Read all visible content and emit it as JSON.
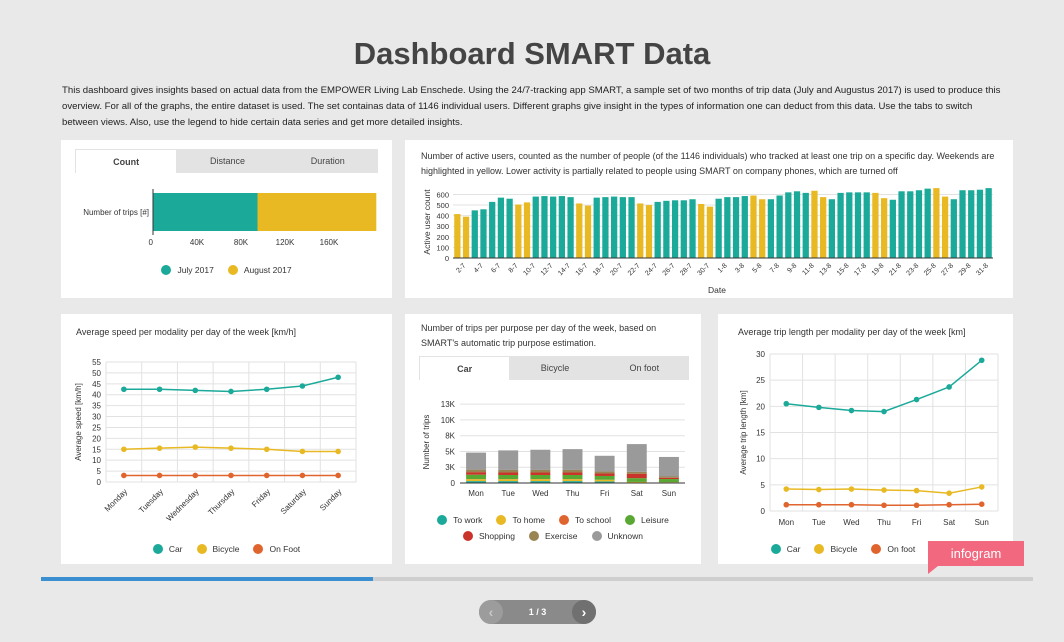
{
  "page": {
    "title": "Dashboard SMART Data",
    "intro": "This dashboard gives insights based on actual data from the EMPOWER Living Lab Enschede. Using the 24/7-tracking app SMART, a sample set of two months of trip data (July and Augustus 2017) is used to produce this overview. For all of the graphs, the entire dataset is used. The set containas data of 1146 individual users. Different graphs give insight in the types of information one can deduct from this data. Use the tabs to switch between views. Also,  use the legend to hide certain data series and get more detailed insights."
  },
  "colors": {
    "teal": "#1ba99a",
    "yellow": "#e8b923",
    "orange": "#e0642d",
    "green": "#5aa834",
    "red": "#c9342a",
    "brown": "#9a8453",
    "gray": "#9a9a9a",
    "accent": "#3a8fd1",
    "infogram": "#f2687f"
  },
  "trips_panel": {
    "tabs": [
      "Count",
      "Distance",
      "Duration"
    ],
    "active_tab": 0
  },
  "active_users_panel": {
    "title": "Number of active users, counted as the number of people (of the 1146 individuals) who tracked at least one trip on a specific day. Weekends are highlighted in yellow. Lower activity is partially related to people using SMART on company phones, which are turned off"
  },
  "speed_panel": {
    "title": "Average speed per modality per day of the week [km/h]"
  },
  "purpose_panel": {
    "title": "Number of trips per purpose per day of the week, based on SMART's automatic trip purpose estimation.",
    "tabs": [
      "Car",
      "Bicycle",
      "On foot"
    ],
    "active_tab": 0
  },
  "length_panel": {
    "title": "Average trip length per modality per day of the week [km]"
  },
  "chart_data": [
    {
      "type": "bar",
      "orientation": "horizontal",
      "stacked": true,
      "categories": [
        "Number of trips [#]"
      ],
      "series": [
        {
          "name": "July 2017",
          "values": [
            95000
          ]
        },
        {
          "name": "August 2017",
          "values": [
            108000
          ]
        }
      ],
      "xticks": [
        "0",
        "40K",
        "80K",
        "120K",
        "160K"
      ],
      "xlim": [
        0,
        200000
      ],
      "legend": "bottom"
    },
    {
      "type": "bar",
      "xlabel": "Date",
      "ylabel": "Active user count",
      "yticks": [
        0,
        100,
        200,
        300,
        400,
        500,
        600
      ],
      "ylim": [
        0,
        680
      ],
      "xtick_labels": [
        "2-7",
        "4-7",
        "6-7",
        "8-7",
        "10-7",
        "12-7",
        "14-7",
        "16-7",
        "18-7",
        "20-7",
        "22-7",
        "24-7",
        "26-7",
        "28-7",
        "30-7",
        "1-8",
        "3-8",
        "5-8",
        "7-8",
        "9-8",
        "11-8",
        "13-8",
        "15-8",
        "17-8",
        "19-8",
        "21-8",
        "23-8",
        "25-8",
        "27-8",
        "29-8",
        "31-8"
      ],
      "categories": [
        "1-7",
        "2-7",
        "3-7",
        "4-7",
        "5-7",
        "6-7",
        "7-7",
        "8-7",
        "9-7",
        "10-7",
        "11-7",
        "12-7",
        "13-7",
        "14-7",
        "15-7",
        "16-7",
        "17-7",
        "18-7",
        "19-7",
        "20-7",
        "21-7",
        "22-7",
        "23-7",
        "24-7",
        "25-7",
        "26-7",
        "27-7",
        "28-7",
        "29-7",
        "30-7",
        "31-7",
        "1-8",
        "2-8",
        "3-8",
        "4-8",
        "5-8",
        "6-8",
        "7-8",
        "8-8",
        "9-8",
        "10-8",
        "11-8",
        "12-8",
        "13-8",
        "14-8",
        "15-8",
        "16-8",
        "17-8",
        "18-8",
        "19-8",
        "20-8",
        "21-8",
        "22-8",
        "23-8",
        "24-8",
        "25-8",
        "26-8",
        "27-8",
        "28-8",
        "29-8",
        "30-8",
        "31-8"
      ],
      "values": [
        415,
        390,
        450,
        460,
        530,
        570,
        560,
        505,
        525,
        580,
        585,
        580,
        585,
        575,
        515,
        495,
        570,
        575,
        580,
        575,
        575,
        515,
        500,
        530,
        540,
        545,
        545,
        555,
        510,
        485,
        560,
        575,
        575,
        585,
        590,
        555,
        555,
        590,
        620,
        630,
        615,
        635,
        575,
        555,
        615,
        620,
        620,
        620,
        615,
        565,
        550,
        630,
        630,
        640,
        655,
        660,
        580,
        555,
        640,
        640,
        645,
        660
      ],
      "weekend": [
        true,
        true,
        false,
        false,
        false,
        false,
        false,
        true,
        true,
        false,
        false,
        false,
        false,
        false,
        true,
        true,
        false,
        false,
        false,
        false,
        false,
        true,
        true,
        false,
        false,
        false,
        false,
        false,
        true,
        true,
        false,
        false,
        false,
        false,
        true,
        true,
        false,
        false,
        false,
        false,
        false,
        true,
        true,
        false,
        false,
        false,
        false,
        false,
        true,
        true,
        false,
        false,
        false,
        false,
        false,
        true,
        true,
        false,
        false,
        false,
        false,
        false
      ]
    },
    {
      "type": "line",
      "ylabel": "Average speed [km/h]",
      "categories": [
        "Monday",
        "Tuesday",
        "Wednesday",
        "Thursday",
        "Friday",
        "Saturday",
        "Sunday"
      ],
      "yticks": [
        0,
        5,
        10,
        15,
        20,
        25,
        30,
        35,
        40,
        45,
        50,
        55
      ],
      "ylim": [
        0,
        55
      ],
      "series": [
        {
          "name": "Car",
          "values": [
            42.5,
            42.5,
            42,
            41.5,
            42.5,
            44,
            48
          ]
        },
        {
          "name": "Bicycle",
          "values": [
            15,
            15.5,
            16,
            15.5,
            15,
            14,
            14
          ]
        },
        {
          "name": "On Foot",
          "values": [
            3,
            3,
            3,
            3,
            3,
            3,
            3
          ]
        }
      ],
      "legend": "bottom"
    },
    {
      "type": "bar",
      "stacked": true,
      "ylabel": "Number of trips",
      "categories": [
        "Mon",
        "Tue",
        "Wed",
        "Thu",
        "Fri",
        "Sat",
        "Sun"
      ],
      "yticks": [
        "0",
        "3K",
        "5K",
        "8K",
        "10K",
        "13K"
      ],
      "ylim": [
        0,
        13000
      ],
      "series": [
        {
          "name": "To work",
          "values": [
            300,
            300,
            300,
            300,
            250,
            80,
            60
          ]
        },
        {
          "name": "To home",
          "values": [
            300,
            300,
            300,
            300,
            250,
            80,
            60
          ]
        },
        {
          "name": "To school",
          "values": [
            20,
            20,
            20,
            20,
            15,
            10,
            10
          ]
        },
        {
          "name": "Leisure",
          "values": [
            700,
            650,
            650,
            650,
            600,
            600,
            500
          ]
        },
        {
          "name": "Shopping",
          "values": [
            400,
            400,
            400,
            400,
            400,
            700,
            200
          ]
        },
        {
          "name": "Exercise",
          "values": [
            400,
            400,
            400,
            400,
            300,
            300,
            200
          ]
        },
        {
          "name": "Unknown",
          "values": [
            2700,
            3100,
            3200,
            3300,
            2500,
            4400,
            3100
          ]
        }
      ],
      "legend": "bottom"
    },
    {
      "type": "line",
      "ylabel": "Average trip length [km]",
      "categories": [
        "Mon",
        "Tue",
        "Wed",
        "Thu",
        "Fri",
        "Sat",
        "Sun"
      ],
      "yticks": [
        0,
        5,
        10,
        15,
        20,
        25,
        30
      ],
      "ylim": [
        0,
        30
      ],
      "series": [
        {
          "name": "Car",
          "values": [
            20.5,
            19.8,
            19.2,
            19,
            21.3,
            23.7,
            28.8
          ]
        },
        {
          "name": "Bicycle",
          "values": [
            4.2,
            4.1,
            4.2,
            4,
            3.9,
            3.4,
            4.6
          ]
        },
        {
          "name": "On foot",
          "values": [
            1.2,
            1.2,
            1.2,
            1.1,
            1.1,
            1.2,
            1.3
          ]
        }
      ],
      "legend": "bottom"
    }
  ],
  "progress": {
    "fraction": 0.335
  },
  "pager": {
    "label": "1 / 3",
    "prev": "‹",
    "next": "›"
  },
  "watermark": {
    "label": "infogram"
  }
}
